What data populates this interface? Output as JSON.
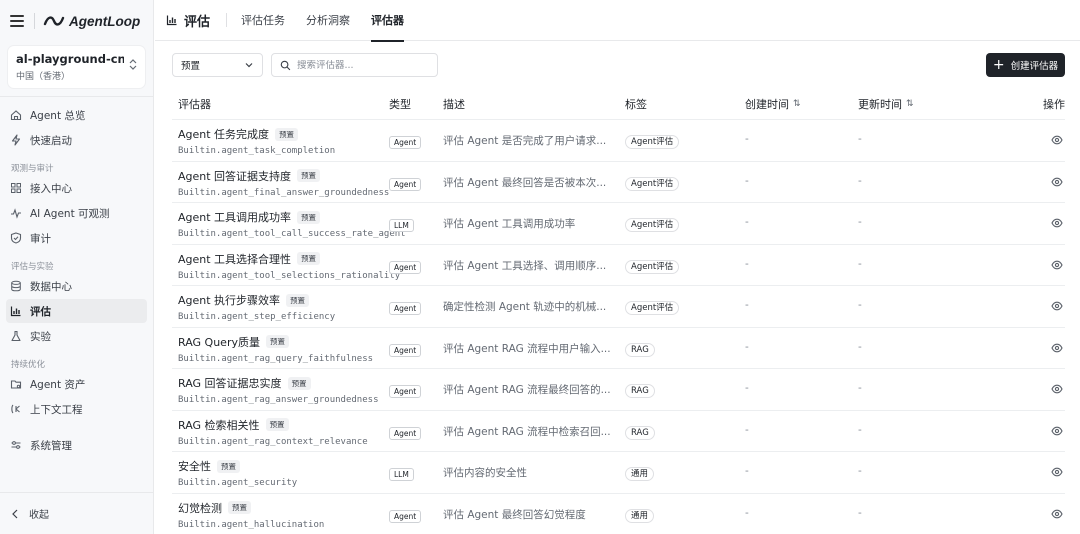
{
  "app": {
    "logo": "AgentLoop"
  },
  "workspace": {
    "name": "al-playground-cn-...",
    "region": "中国（香港）"
  },
  "sidebar": {
    "items_top": [
      {
        "label": "Agent 总览",
        "icon": "home-icon"
      },
      {
        "label": "快速启动",
        "icon": "bolt-icon"
      }
    ],
    "group1": "观测与审计",
    "items_g1": [
      {
        "label": "接入中心",
        "icon": "grid-icon"
      },
      {
        "label": "AI Agent 可观测",
        "icon": "pulse-icon"
      },
      {
        "label": "审计",
        "icon": "shield-icon"
      }
    ],
    "group2": "评估与实验",
    "items_g2": [
      {
        "label": "数据中心",
        "icon": "database-icon"
      },
      {
        "label": "评估",
        "icon": "bar-chart-icon"
      },
      {
        "label": "实验",
        "icon": "flask-icon"
      }
    ],
    "group3": "持续优化",
    "items_g3": [
      {
        "label": "Agent 资产",
        "icon": "folder-icon"
      },
      {
        "label": "上下文工程",
        "icon": "context-icon"
      }
    ],
    "system": {
      "label": "系统管理",
      "icon": "sliders-icon"
    },
    "collapse": "收起"
  },
  "header": {
    "title": "评估",
    "tabs": [
      {
        "label": "评估任务"
      },
      {
        "label": "分析洞察"
      },
      {
        "label": "评估器"
      }
    ],
    "active_tab": "评估器"
  },
  "toolbar": {
    "filter_value": "预置",
    "search_placeholder": "搜索评估器...",
    "create_label": "创建评估器"
  },
  "table": {
    "columns": {
      "name": "评估器",
      "type": "类型",
      "desc": "描述",
      "label": "标签",
      "created": "创建时间",
      "updated": "更新时间",
      "op": "操作"
    },
    "sort_icon": "⇅",
    "preset_badge": "预置",
    "rows": [
      {
        "name": "Agent 任务完成度",
        "id": "Builtin.agent_task_completion",
        "type": "Agent",
        "desc": "评估 Agent 是否完成了用户请求...",
        "label": "Agent评估",
        "created": "-",
        "updated": "-"
      },
      {
        "name": "Agent 回答证据支持度",
        "id": "Builtin.agent_final_answer_groundedness",
        "type": "Agent",
        "desc": "评估 Agent 最终回答是否被本次...",
        "label": "Agent评估",
        "created": "-",
        "updated": "-"
      },
      {
        "name": "Agent 工具调用成功率",
        "id": "Builtin.agent_tool_call_success_rate_agent",
        "type": "LLM",
        "desc": "评估 Agent 工具调用成功率",
        "label": "Agent评估",
        "created": "-",
        "updated": "-"
      },
      {
        "name": "Agent 工具选择合理性",
        "id": "Builtin.agent_tool_selections_rationality",
        "type": "Agent",
        "desc": "评估 Agent 工具选择、调用顺序...",
        "label": "Agent评估",
        "created": "-",
        "updated": "-"
      },
      {
        "name": "Agent 执行步骤效率",
        "id": "Builtin.agent_step_efficiency",
        "type": "Agent",
        "desc": "确定性检测 Agent 轨迹中的机械...",
        "label": "Agent评估",
        "created": "-",
        "updated": "-"
      },
      {
        "name": "RAG Query质量",
        "id": "Builtin.agent_rag_query_faithfulness",
        "type": "Agent",
        "desc": "评估 Agent RAG 流程中用户输入...",
        "label": "RAG",
        "created": "-",
        "updated": "-"
      },
      {
        "name": "RAG 回答证据忠实度",
        "id": "Builtin.agent_rag_answer_groundedness",
        "type": "Agent",
        "desc": "评估 Agent RAG 流程最终回答的...",
        "label": "RAG",
        "created": "-",
        "updated": "-"
      },
      {
        "name": "RAG 检索相关性",
        "id": "Builtin.agent_rag_context_relevance",
        "type": "Agent",
        "desc": "评估 Agent RAG 流程中检索召回...",
        "label": "RAG",
        "created": "-",
        "updated": "-"
      },
      {
        "name": "安全性",
        "id": "Builtin.agent_security",
        "type": "LLM",
        "desc": "评估内容的安全性",
        "label": "通用",
        "created": "-",
        "updated": "-"
      },
      {
        "name": "幻觉检测",
        "id": "Builtin.agent_hallucination",
        "type": "Agent",
        "desc": "评估 Agent 最终回答幻觉程度",
        "label": "通用",
        "created": "-",
        "updated": "-"
      }
    ]
  }
}
